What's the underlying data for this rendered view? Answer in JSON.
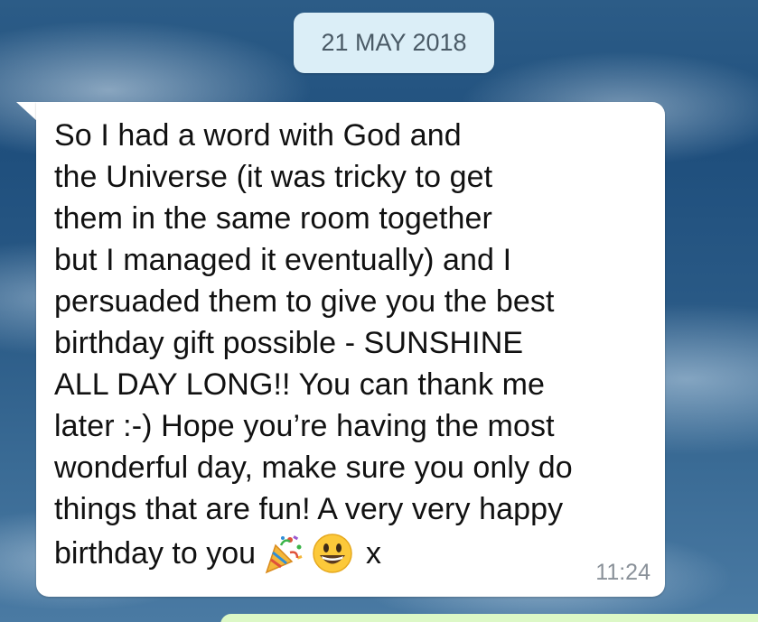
{
  "chat": {
    "date_separator": "21 MAY 2018",
    "message": {
      "lines": "So I had a word with God and\nthe Universe (it was tricky to get\nthem in the same room together\nbut I managed it eventually) and I\npersuaded them to give you the best\nbirthday gift possible - SUNSHINE\nALL DAY LONG!! You can thank me\nlater :-) Hope you’re having the most\nwonderful day, make sure you only do\nthings that are fun! A very very happy",
      "last_line_text": "birthday to you",
      "emojis": [
        "party-popper-icon",
        "grinning-face-icon"
      ],
      "sign_off": "x",
      "time": "11:24"
    }
  }
}
